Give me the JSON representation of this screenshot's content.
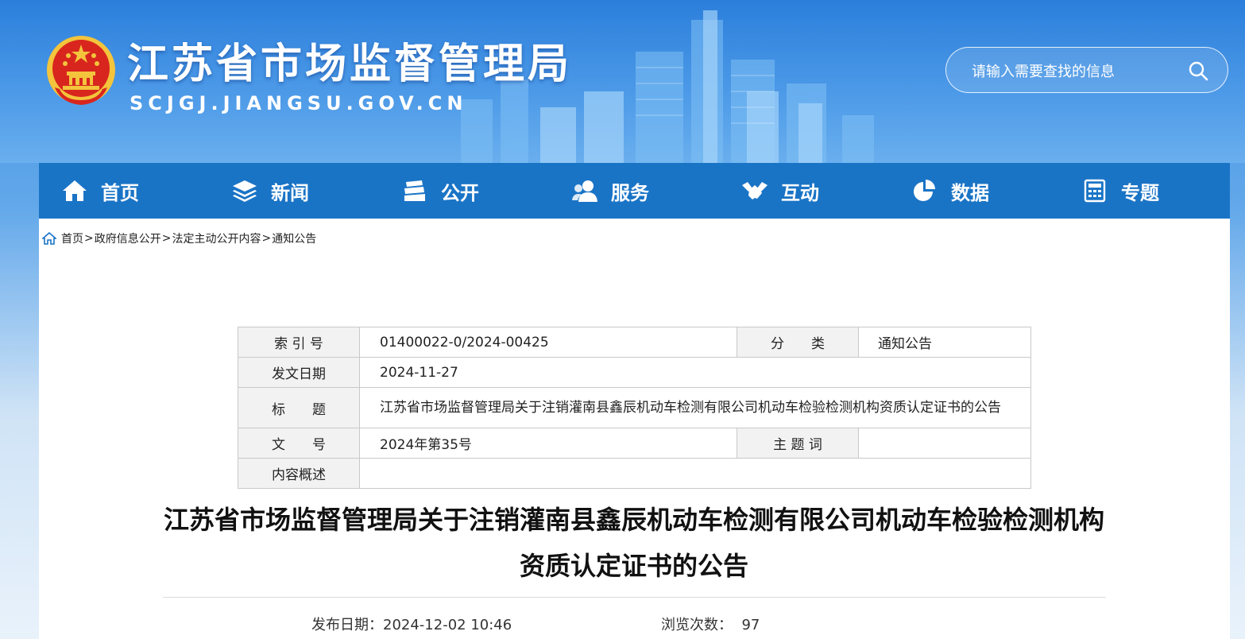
{
  "site": {
    "title": "江苏省市场监督管理局",
    "domain": "SCJGJ.JIANGSU.GOV.CN"
  },
  "search": {
    "placeholder": "请输入需要查找的信息"
  },
  "nav": {
    "items": [
      {
        "label": "首页",
        "icon": "home-icon"
      },
      {
        "label": "新闻",
        "icon": "layers-icon"
      },
      {
        "label": "公开",
        "icon": "documents-icon"
      },
      {
        "label": "服务",
        "icon": "users-icon"
      },
      {
        "label": "互动",
        "icon": "handshake-icon"
      },
      {
        "label": "数据",
        "icon": "pie-chart-icon"
      },
      {
        "label": "专题",
        "icon": "calculator-icon"
      }
    ]
  },
  "breadcrumb": {
    "items": [
      "首页",
      "政府信息公开",
      "法定主动公开内容",
      "通知公告"
    ],
    "separator": ">"
  },
  "meta": {
    "index_label": "索 引 号",
    "index_value": "01400022-0/2024-00425",
    "category_label": "分　　类",
    "category_value": "通知公告",
    "date_label": "发文日期",
    "date_value": "2024-11-27",
    "title_label": "标　　题",
    "title_value": "江苏省市场监督管理局关于注销灌南县鑫辰机动车检测有限公司机动车检验检测机构资质认定证书的公告",
    "doc_no_label": "文　　号",
    "doc_no_value": "2024年第35号",
    "keywords_label": "主 题 词",
    "keywords_value": "",
    "summary_label": "内容概述",
    "summary_value": ""
  },
  "article": {
    "title": "江苏省市场监督管理局关于注销灌南县鑫辰机动车检测有限公司机动车检验检测机构资质认定证书的公告",
    "publish_label": "发布日期：",
    "publish_value": "2024-12-02 10:46",
    "views_label": "浏览次数：",
    "views_value": "97"
  },
  "colors": {
    "nav_bg": "#1a74c6",
    "header_bg": "#2b7fdb",
    "emblem_red": "#d8261e",
    "emblem_gold": "#f3c43c"
  }
}
